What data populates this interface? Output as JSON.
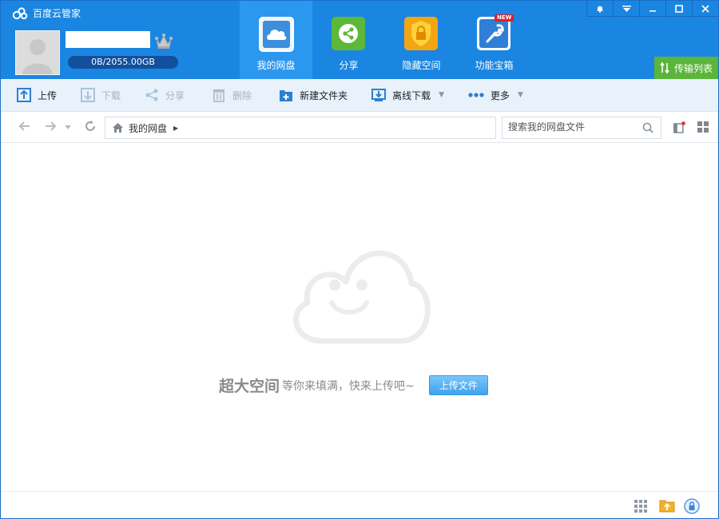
{
  "app": {
    "title": "百度云管家"
  },
  "user": {
    "quota": "0B/2055.00GB"
  },
  "nav": {
    "tabs": [
      {
        "label": "我的网盘",
        "icon": "cloud-drive-icon",
        "active": true
      },
      {
        "label": "分享",
        "icon": "share-icon"
      },
      {
        "label": "隐藏空间",
        "icon": "lock-icon"
      },
      {
        "label": "功能宝箱",
        "icon": "wrench-icon",
        "badge": "NEW"
      }
    ]
  },
  "window_controls": [
    "bell-icon",
    "menu-icon",
    "minimize-icon",
    "maximize-icon",
    "close-icon"
  ],
  "transfer": {
    "label": "传输列表"
  },
  "toolbar": {
    "upload": "上传",
    "download": "下载",
    "share": "分享",
    "delete": "删除",
    "new_folder": "新建文件夹",
    "offline_download": "离线下载",
    "more": "更多"
  },
  "address": {
    "crumb": "我的网盘"
  },
  "search": {
    "placeholder": "搜索我的网盘文件"
  },
  "empty": {
    "headline": "超大空间",
    "subline": "等你来填满，快来上传吧~",
    "button": "上传文件"
  },
  "colors": {
    "header": "#1a86e2",
    "active_tab": "#2c97ef",
    "toolbar": "#e9f1fb",
    "transfer_green": "#5bb53b",
    "quota_bar": "#124f9c"
  }
}
